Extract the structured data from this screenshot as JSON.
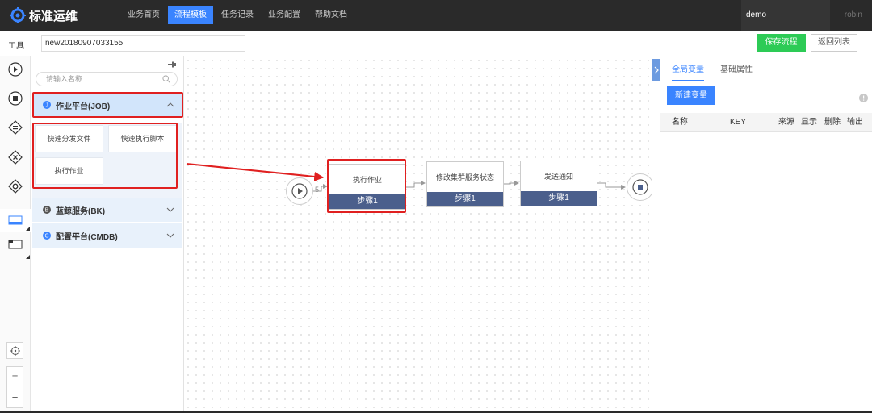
{
  "app": {
    "title": "标准运维"
  },
  "nav": [
    {
      "label": "业务首页",
      "active": false
    },
    {
      "label": "流程模板",
      "active": true
    },
    {
      "label": "任务记录",
      "active": false
    },
    {
      "label": "业务配置",
      "active": false
    },
    {
      "label": "帮助文档",
      "active": false
    }
  ],
  "user": {
    "business": "demo",
    "username": "robin"
  },
  "toolbar": {
    "tools_label": "工具",
    "template_name": "new20180907033155",
    "save_label": "保存流程",
    "back_label": "返回列表"
  },
  "panel": {
    "search_placeholder": "请输入名称",
    "groups": [
      {
        "label": "作业平台(JOB)",
        "expanded": true,
        "items": [
          "快速分发文件",
          "快速执行脚本",
          "执行作业"
        ]
      },
      {
        "label": "蓝鲸服务(BK)",
        "expanded": false
      },
      {
        "label": "配置平台(CMDB)",
        "expanded": false
      }
    ]
  },
  "canvas": {
    "edge_label": "5",
    "nodes": [
      {
        "title": "执行作业",
        "step": "步骤1",
        "highlighted": true
      },
      {
        "title": "修改集群服务状态",
        "step": "步骤1",
        "highlighted": false
      },
      {
        "title": "发送通知",
        "step": "步骤1",
        "highlighted": false
      }
    ]
  },
  "right_panel": {
    "tabs": [
      "全局变量",
      "基础属性"
    ],
    "active_tab": "全局变量",
    "new_variable_label": "新建变量",
    "columns": [
      "名称",
      "KEY",
      "来源",
      "显示",
      "删除",
      "输出"
    ]
  },
  "colors": {
    "accent": "#3a84ff",
    "save": "#2dcb56",
    "step_bar": "#4b5f8c",
    "highlight": "#e02020",
    "topbar": "#2a2a2a"
  },
  "zoom": {
    "in": "+",
    "out": "−"
  }
}
